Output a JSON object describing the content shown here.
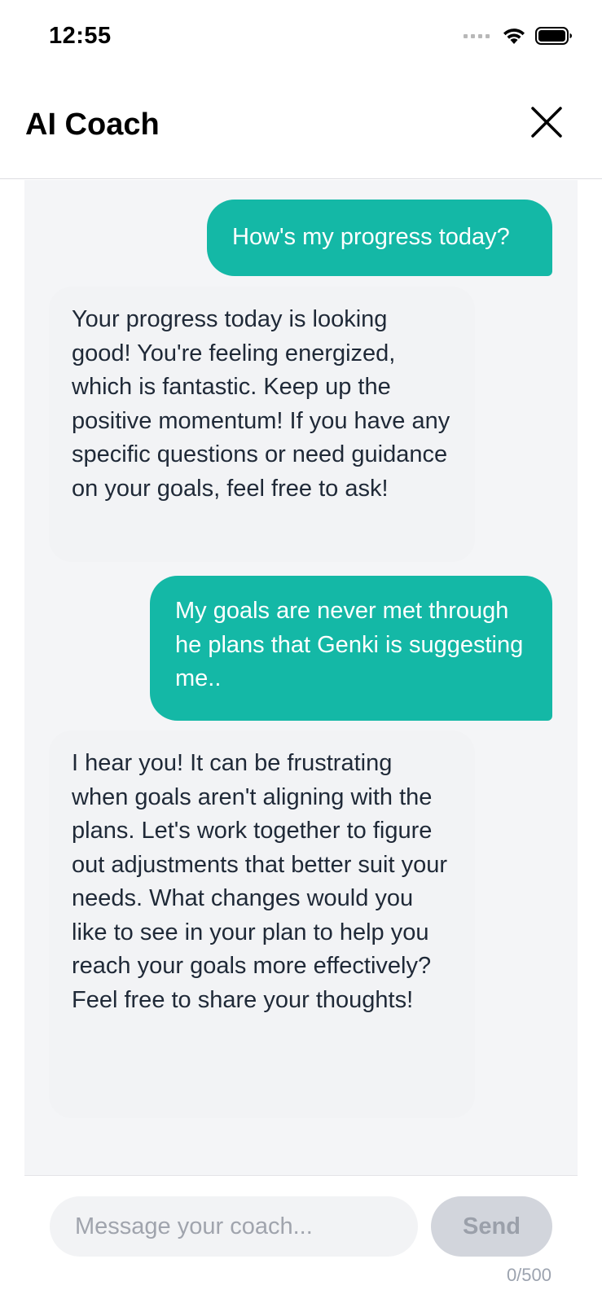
{
  "status_bar": {
    "time": "12:55",
    "icons": [
      "cellular-signal-icon",
      "wifi-icon",
      "battery-icon"
    ]
  },
  "header": {
    "title": "AI Coach",
    "close_icon": "close-icon"
  },
  "messages": [
    {
      "role": "user",
      "text": "How's my progress today?"
    },
    {
      "role": "coach",
      "text": "Your progress today is looking good! You're feeling energized, which is fantastic. Keep up the positive momentum! If you have any specific questions or need guidance on your goals, feel free to ask!"
    },
    {
      "role": "user",
      "text": "My goals are never met through he plans that Genki is suggesting me.."
    },
    {
      "role": "coach",
      "text": "I hear you! It can be frustrating when goals aren't aligning with the plans. Let's work together to figure out adjustments that better suit your needs. What changes would you like to see in your plan to help you reach your goals more effectively? Feel free to share your thoughts!"
    }
  ],
  "composer": {
    "placeholder": "Message your coach...",
    "value": "",
    "send_label": "Send",
    "char_count": "0/500"
  },
  "colors": {
    "accent": "#14b8a6",
    "chat_background": "#f4f5f7",
    "coach_bubble": "#f2f3f5",
    "send_disabled": "#d2d5dc"
  }
}
